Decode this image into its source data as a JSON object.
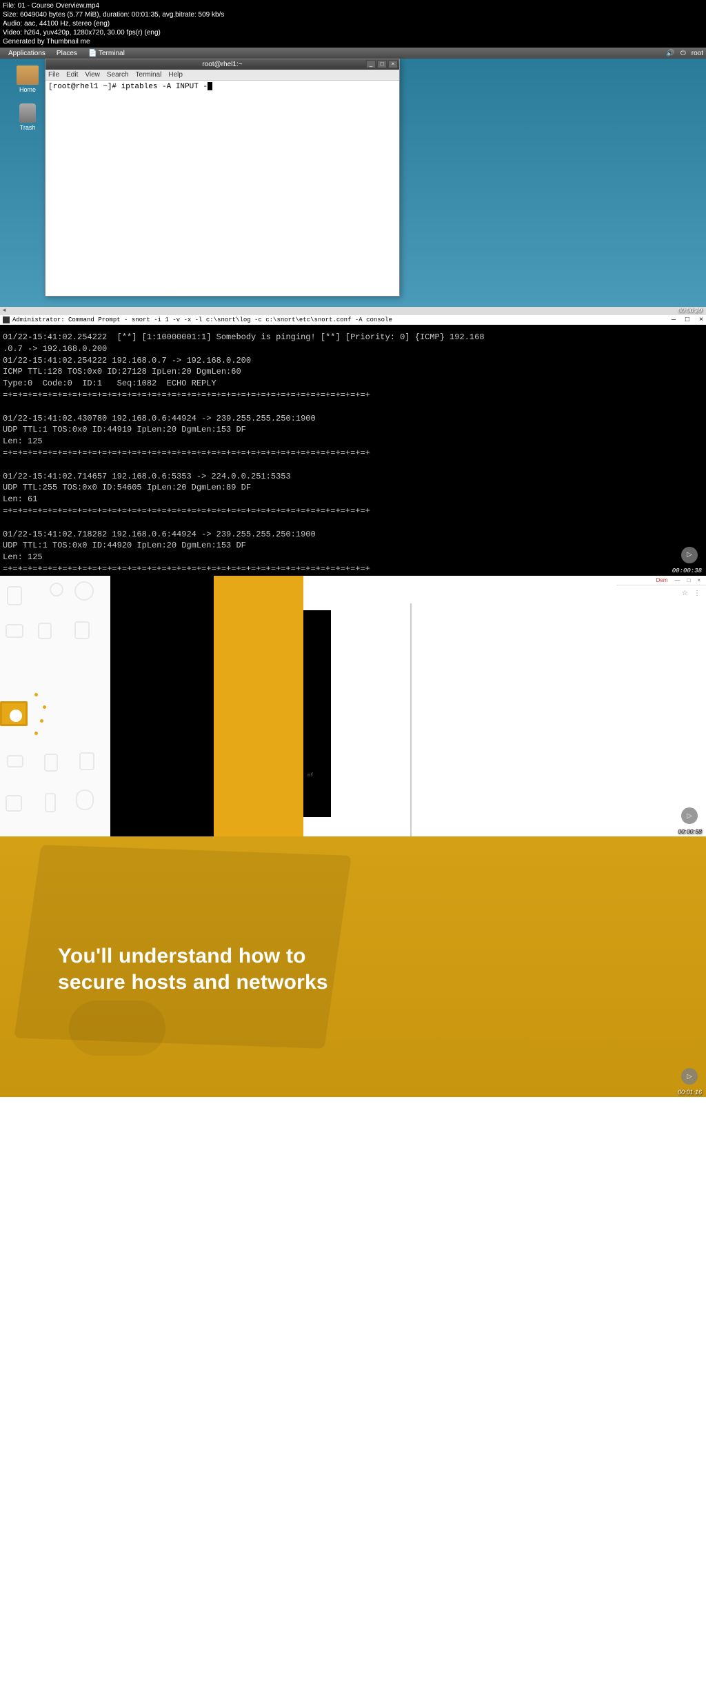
{
  "metadata": {
    "line1": "File: 01 - Course Overview.mp4",
    "line2": "Size: 6049040 bytes (5.77 MiB), duration: 00:01:35, avg.bitrate: 509 kb/s",
    "line3": "Audio: aac, 44100 Hz, stereo (eng)",
    "line4": "Video: h264, yuv420p, 1280x720, 30.00 fps(r) (eng)",
    "line5": "Generated by Thumbnail me"
  },
  "panel": {
    "applications": "Applications",
    "places": "Places",
    "terminal": "Terminal",
    "user": "root"
  },
  "desktop": {
    "home_label": "Home",
    "trash_label": "Trash"
  },
  "terminal": {
    "title": "root@rhel1:~",
    "menu": {
      "file": "File",
      "edit": "Edit",
      "view": "View",
      "search": "Search",
      "terminal": "Terminal",
      "help": "Help"
    },
    "prompt": "[root@rhel1 ~]# iptables -A INPUT -"
  },
  "timestamps": {
    "t1": "00:00:20",
    "t2": "00:00:38",
    "t3": "00:00:58",
    "t4": "00:01:16"
  },
  "cmd": {
    "title": "Administrator: Command Prompt - snort  -i 1 -v -x -l c:\\snort\\log -c c:\\snort\\etc\\snort.conf -A console",
    "body": "01/22-15:41:02.254222  [**] [1:10000001:1] Somebody is pinging! [**] [Priority: 0] {ICMP} 192.168\n.0.7 -> 192.168.0.200\n01/22-15:41:02.254222 192.168.0.7 -> 192.168.0.200\nICMP TTL:128 TOS:0x0 ID:27128 IpLen:20 DgmLen:60\nType:0  Code:0  ID:1   Seq:1082  ECHO REPLY\n=+=+=+=+=+=+=+=+=+=+=+=+=+=+=+=+=+=+=+=+=+=+=+=+=+=+=+=+=+=+=+=+=+=+=+=+=+\n\n01/22-15:41:02.430780 192.168.0.6:44924 -> 239.255.255.250:1900\nUDP TTL:1 TOS:0x0 ID:44919 IpLen:20 DgmLen:153 DF\nLen: 125\n=+=+=+=+=+=+=+=+=+=+=+=+=+=+=+=+=+=+=+=+=+=+=+=+=+=+=+=+=+=+=+=+=+=+=+=+=+\n\n01/22-15:41:02.714657 192.168.0.6:5353 -> 224.0.0.251:5353\nUDP TTL:255 TOS:0x0 ID:54605 IpLen:20 DgmLen:89 DF\nLen: 61\n=+=+=+=+=+=+=+=+=+=+=+=+=+=+=+=+=+=+=+=+=+=+=+=+=+=+=+=+=+=+=+=+=+=+=+=+=+\n\n01/22-15:41:02.718282 192.168.0.6:44924 -> 239.255.255.250:1900\nUDP TTL:1 TOS:0x0 ID:44920 IpLen:20 DgmLen:153 DF\nLen: 125\n=+=+=+=+=+=+=+=+=+=+=+=+=+=+=+=+=+=+=+=+=+=+=+=+=+=+=+=+=+=+=+=+=+=+=+=+=+"
  },
  "panel3": {
    "browser_text": "Dem",
    "conf_text": "nf"
  },
  "panel4": {
    "headline_line1": "You'll understand how to",
    "headline_line2": "secure hosts and networks"
  }
}
